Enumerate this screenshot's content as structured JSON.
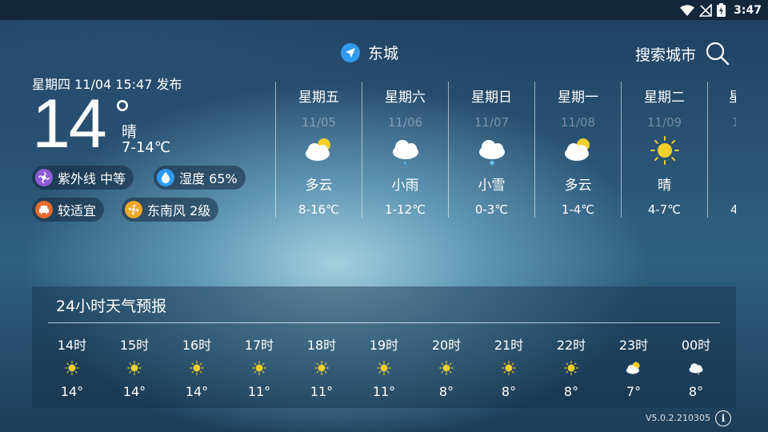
{
  "status_bar": {
    "time": "3:47"
  },
  "location": {
    "city": "东城"
  },
  "search": {
    "label": "搜索城市"
  },
  "current": {
    "published": "星期四  11/04  15:47 发布",
    "temperature": "14",
    "degree_symbol": "°",
    "condition": "晴",
    "range": "7-14℃",
    "chips": {
      "uv": "紫外线 中等",
      "humidity": "湿度 65%",
      "car_wash": "较适宜",
      "wind": "东南风 2级"
    }
  },
  "daily": [
    {
      "day": "星期五",
      "date": "11/05",
      "icon": "partly-cloudy",
      "condition": "多云",
      "range": "8-16℃"
    },
    {
      "day": "星期六",
      "date": "11/06",
      "icon": "light-rain",
      "condition": "小雨",
      "range": "1-12℃"
    },
    {
      "day": "星期日",
      "date": "11/07",
      "icon": "light-snow",
      "condition": "小雪",
      "range": "0-3℃"
    },
    {
      "day": "星期一",
      "date": "11/08",
      "icon": "partly-cloudy",
      "condition": "多云",
      "range": "1-4℃"
    },
    {
      "day": "星期二",
      "date": "11/09",
      "icon": "sunny",
      "condition": "晴",
      "range": "4-7℃"
    },
    {
      "day": "星",
      "date": "1",
      "icon": "",
      "condition": "",
      "range": "4"
    }
  ],
  "hourly": {
    "title": "24小时天气预报",
    "items": [
      {
        "time": "14时",
        "icon": "sunny",
        "temp": "14°"
      },
      {
        "time": "15时",
        "icon": "sunny",
        "temp": "14°"
      },
      {
        "time": "16时",
        "icon": "sunny",
        "temp": "14°"
      },
      {
        "time": "17时",
        "icon": "sunny",
        "temp": "11°"
      },
      {
        "time": "18时",
        "icon": "sunny",
        "temp": "11°"
      },
      {
        "time": "19时",
        "icon": "sunny",
        "temp": "11°"
      },
      {
        "time": "20时",
        "icon": "sunny",
        "temp": "8°"
      },
      {
        "time": "21时",
        "icon": "sunny",
        "temp": "8°"
      },
      {
        "time": "22时",
        "icon": "sunny",
        "temp": "8°"
      },
      {
        "time": "23时",
        "icon": "partly-cloudy",
        "temp": "7°"
      },
      {
        "time": "00时",
        "icon": "cloudy",
        "temp": "8°"
      }
    ]
  },
  "version": "V5.0.2.210305",
  "colors": {
    "accent": "#2f9bf0",
    "sun": "#f4cf2a"
  }
}
